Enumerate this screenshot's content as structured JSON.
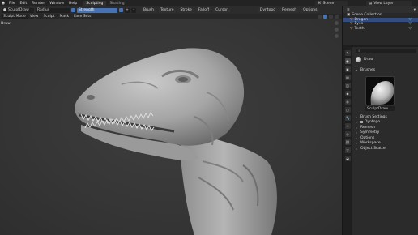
{
  "menubar": {
    "items": [
      "File",
      "Edit",
      "Render",
      "Window",
      "Help"
    ],
    "workspaces": [
      {
        "label": "Sculpting",
        "active": true
      },
      {
        "label": "Shading",
        "active": false
      }
    ],
    "scene": "Scene",
    "view_layer": "View Layer"
  },
  "toolheader": {
    "brush": "SculptDraw",
    "radius_label": "Radius",
    "radius_value": "",
    "strength_label": "Strength",
    "strength_value": "",
    "direction_buttons": [
      "+",
      "-"
    ],
    "menus": [
      "Brush",
      "Texture",
      "Stroke",
      "Falloff",
      "Cursor"
    ],
    "right_menus": [
      "Dyntopo",
      "Remesh",
      "Options"
    ]
  },
  "viewport_header": {
    "mode": "Sculpt Mode",
    "menus": [
      "View",
      "Sculpt",
      "Mask",
      "Face Sets"
    ]
  },
  "viewport": {
    "mode_label": "Draw"
  },
  "outliner": {
    "title": "Scene Collection",
    "rows": [
      {
        "name": "Dragon",
        "selected": true
      },
      {
        "name": "Eyes",
        "selected": false
      },
      {
        "name": "Teeth",
        "selected": false
      }
    ]
  },
  "properties": {
    "tool_name": "Draw",
    "brushes_header": "Brushes",
    "brush_name": "SculptDraw",
    "sections": [
      "Brush Settings",
      "Dyntopo",
      "Remesh",
      "Symmetry",
      "Options",
      "Workspace",
      "Object Scatter"
    ]
  },
  "colors": {
    "accent": "#4772b3",
    "selection": "#334d80",
    "object_orange": "#e8a44c",
    "mesh_teal": "#5fc7d9"
  }
}
